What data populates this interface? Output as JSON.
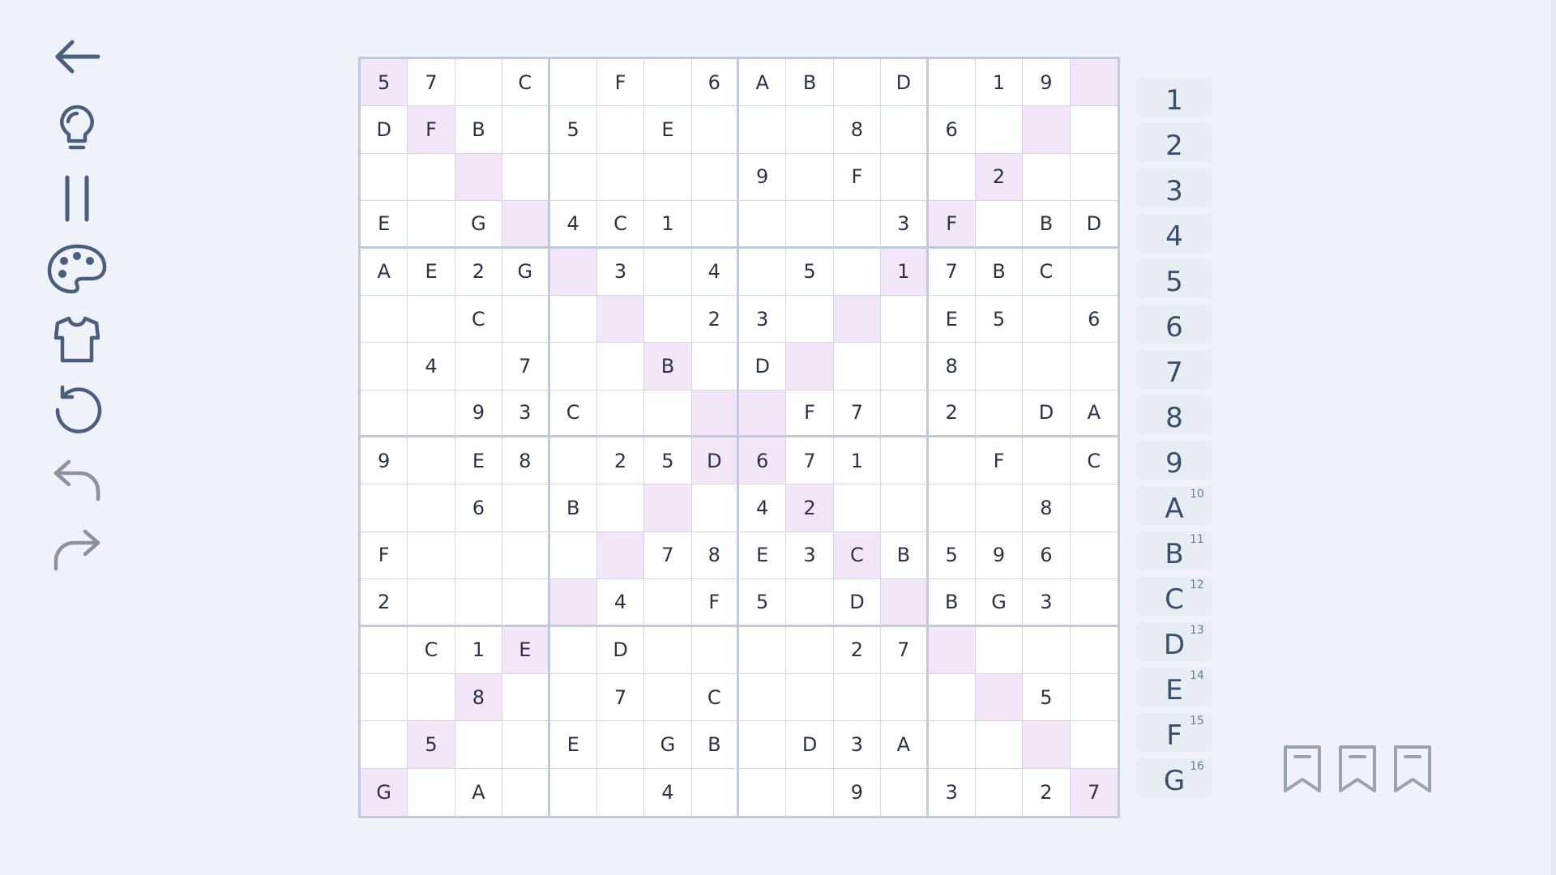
{
  "toolbar": {
    "items": [
      {
        "name": "back-arrow-icon",
        "enabled": true
      },
      {
        "name": "lightbulb-icon",
        "enabled": true
      },
      {
        "name": "pause-icon",
        "enabled": true
      },
      {
        "name": "palette-icon",
        "enabled": true
      },
      {
        "name": "shirt-icon",
        "enabled": true
      },
      {
        "name": "restart-icon",
        "enabled": true
      },
      {
        "name": "undo-icon",
        "enabled": false
      },
      {
        "name": "redo-icon",
        "enabled": false
      }
    ]
  },
  "colors": {
    "icon": "#4a5f7f",
    "icon_disabled": "#8c939c",
    "highlight": "#f3e6f8",
    "grid_line": "#cfd7e4",
    "box_line": "#bfcbdd",
    "numpad_bg": "#e8edf3",
    "numpad_text": "#38506e",
    "bookmark": "#9ba3ad"
  },
  "board": {
    "size": 16,
    "rows": [
      [
        "5",
        "7",
        "",
        "C",
        "",
        "F",
        "",
        "6",
        "A",
        "B",
        "",
        "D",
        "",
        "1",
        "9",
        ""
      ],
      [
        "D",
        "F",
        "B",
        "",
        "5",
        "",
        "E",
        "",
        "",
        "",
        "8",
        "",
        "6",
        "",
        "",
        ""
      ],
      [
        "",
        "",
        "",
        "",
        "",
        "",
        "",
        "",
        "9",
        "",
        "F",
        "",
        "",
        "2",
        "",
        ""
      ],
      [
        "E",
        "",
        "G",
        "",
        "4",
        "C",
        "1",
        "",
        "",
        "",
        "",
        "3",
        "F",
        "",
        "B",
        "D"
      ],
      [
        "A",
        "E",
        "2",
        "G",
        "",
        "3",
        "",
        "4",
        "",
        "5",
        "",
        "1",
        "7",
        "B",
        "C",
        ""
      ],
      [
        "",
        "",
        "C",
        "",
        "",
        "",
        "",
        "2",
        "3",
        "",
        "",
        "",
        "E",
        "5",
        "",
        "6"
      ],
      [
        "",
        "4",
        "",
        "7",
        "",
        "",
        "B",
        "",
        "D",
        "",
        "",
        "",
        "8",
        "",
        "",
        ""
      ],
      [
        "",
        "",
        "9",
        "3",
        "C",
        "",
        "",
        "",
        "",
        "F",
        "7",
        "",
        "2",
        "",
        "D",
        "A"
      ],
      [
        "9",
        "",
        "E",
        "8",
        "",
        "2",
        "5",
        "D",
        "6",
        "7",
        "1",
        "",
        "",
        "F",
        "",
        "C"
      ],
      [
        "",
        "",
        "6",
        "",
        "B",
        "",
        "",
        "",
        "4",
        "2",
        "",
        "",
        "",
        "",
        "8",
        ""
      ],
      [
        "F",
        "",
        "",
        "",
        "",
        "",
        "7",
        "8",
        "E",
        "3",
        "C",
        "B",
        "5",
        "9",
        "6",
        ""
      ],
      [
        "2",
        "",
        "",
        "",
        "",
        "4",
        "",
        "F",
        "5",
        "",
        "D",
        "",
        "B",
        "G",
        "3",
        ""
      ],
      [
        "",
        "C",
        "1",
        "E",
        "",
        "D",
        "",
        "",
        "",
        "",
        "2",
        "7",
        "",
        "",
        "",
        ""
      ],
      [
        "",
        "",
        "8",
        "",
        "",
        "7",
        "",
        "C",
        "",
        "",
        "",
        "",
        "",
        "",
        "5",
        ""
      ],
      [
        "",
        "5",
        "",
        "",
        "E",
        "",
        "G",
        "B",
        "",
        "D",
        "3",
        "A",
        "",
        "",
        "",
        ""
      ],
      [
        "G",
        "",
        "A",
        "",
        "",
        "",
        "4",
        "",
        "",
        "",
        "9",
        "",
        "3",
        "",
        "2",
        "7"
      ]
    ],
    "highlighted": [
      [
        0,
        0
      ],
      [
        0,
        15
      ],
      [
        1,
        1
      ],
      [
        1,
        14
      ],
      [
        2,
        2
      ],
      [
        2,
        13
      ],
      [
        3,
        3
      ],
      [
        3,
        12
      ],
      [
        4,
        4
      ],
      [
        4,
        11
      ],
      [
        5,
        5
      ],
      [
        5,
        10
      ],
      [
        6,
        6
      ],
      [
        6,
        9
      ],
      [
        7,
        7
      ],
      [
        7,
        8
      ],
      [
        8,
        7
      ],
      [
        8,
        8
      ],
      [
        9,
        6
      ],
      [
        9,
        9
      ],
      [
        10,
        5
      ],
      [
        10,
        10
      ],
      [
        11,
        4
      ],
      [
        11,
        11
      ],
      [
        12,
        3
      ],
      [
        12,
        12
      ],
      [
        13,
        2
      ],
      [
        13,
        13
      ],
      [
        14,
        1
      ],
      [
        14,
        14
      ],
      [
        15,
        0
      ],
      [
        15,
        15
      ]
    ]
  },
  "numpad": [
    {
      "label": "1",
      "sub": ""
    },
    {
      "label": "2",
      "sub": ""
    },
    {
      "label": "3",
      "sub": ""
    },
    {
      "label": "4",
      "sub": ""
    },
    {
      "label": "5",
      "sub": ""
    },
    {
      "label": "6",
      "sub": ""
    },
    {
      "label": "7",
      "sub": ""
    },
    {
      "label": "8",
      "sub": ""
    },
    {
      "label": "9",
      "sub": ""
    },
    {
      "label": "A",
      "sub": "10"
    },
    {
      "label": "B",
      "sub": "11"
    },
    {
      "label": "C",
      "sub": "12"
    },
    {
      "label": "D",
      "sub": "13"
    },
    {
      "label": "E",
      "sub": "14"
    },
    {
      "label": "F",
      "sub": "15"
    },
    {
      "label": "G",
      "sub": "16"
    }
  ],
  "bookmarks": [
    {
      "name": "bookmark-icon"
    },
    {
      "name": "bookmark-icon"
    },
    {
      "name": "bookmark-icon"
    }
  ]
}
